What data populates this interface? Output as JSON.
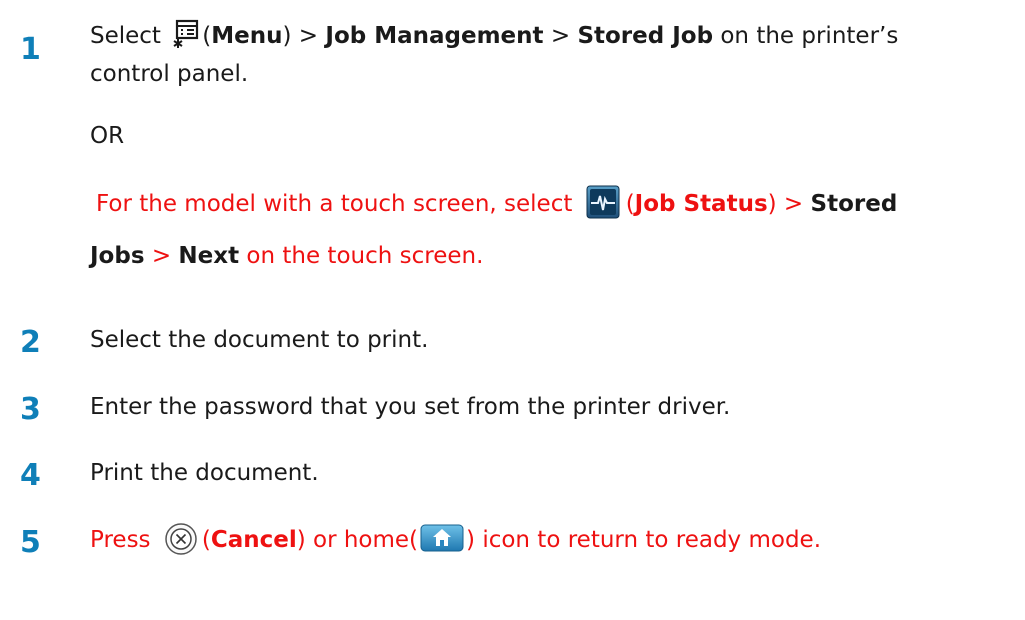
{
  "steps": [
    {
      "number": "1",
      "line1": {
        "pre": "Select ",
        "icon": "menu-icon",
        "paren_open": "(",
        "menu": "Menu",
        "paren_close": ")",
        "sep1": " > ",
        "job_management": "Job Management",
        "sep2": " > ",
        "stored_job": "Stored Job",
        "post": " on the printer’s"
      },
      "line2": "control panel.",
      "or": "OR",
      "touch": {
        "pre": "For the model with a touch screen, select ",
        "icon": "job-status-icon",
        "paren_open": "(",
        "job_status": "Job Status",
        "paren_close": ")",
        "sep1": " > ",
        "stored": "Stored",
        "jobs": "Jobs",
        "sep2": " > ",
        "next": "Next",
        "post": " on the touch screen."
      }
    },
    {
      "number": "2",
      "text": "Select the document to print."
    },
    {
      "number": "3",
      "text": "Enter the password that you set from the printer driver."
    },
    {
      "number": "4",
      "text": "Print the document."
    },
    {
      "number": "5",
      "pre": "Press ",
      "icon": "cancel-icon",
      "paren_open": "(",
      "cancel": "Cancel",
      "mid": ") or home(",
      "home_icon": "home-icon",
      "post": ") icon to return to ready mode."
    }
  ],
  "colors": {
    "step_number": "#0f7fb8",
    "highlight": "#ee1111",
    "text": "#1a1a1a"
  }
}
